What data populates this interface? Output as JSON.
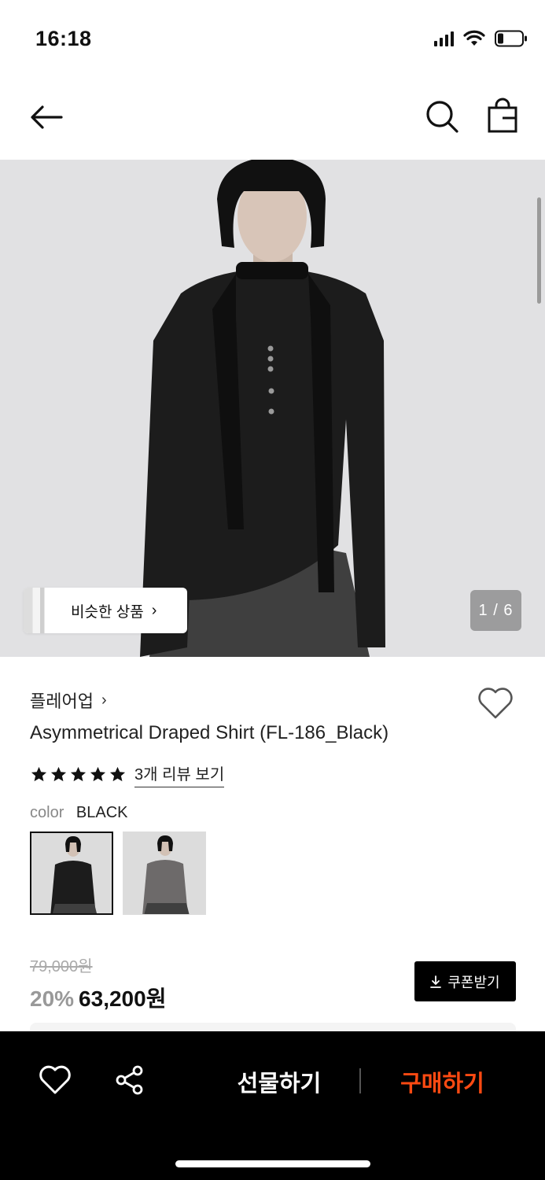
{
  "status": {
    "time": "16:18"
  },
  "icons": {
    "back": "arrow-left-icon",
    "search": "search-icon",
    "bag": "shopping-bag-icon",
    "wish": "heart-icon",
    "share": "share-icon",
    "download": "download-icon"
  },
  "hero": {
    "similar_label": "비슷한 상품",
    "similar_chevron": "›",
    "counter": "1 / 6"
  },
  "product": {
    "brand": "플레어업",
    "brand_chevron": "›",
    "title": "Asymmetrical Draped Shirt (FL-186_Black)",
    "rating_stars": 5,
    "reviews_link": "3개 리뷰 보기",
    "color_label": "color",
    "color_value": "BLACK",
    "swatches": [
      "black",
      "gray"
    ],
    "original_price": "79,000원",
    "discount": "20%",
    "sale_price": "63,200원",
    "coupon_label": "쿠폰받기"
  },
  "bottom_bar": {
    "gift_label": "선물하기",
    "buy_label": "구매하기"
  },
  "colors": {
    "buy_accent": "#ff4a12",
    "bar_background": "#000000"
  }
}
